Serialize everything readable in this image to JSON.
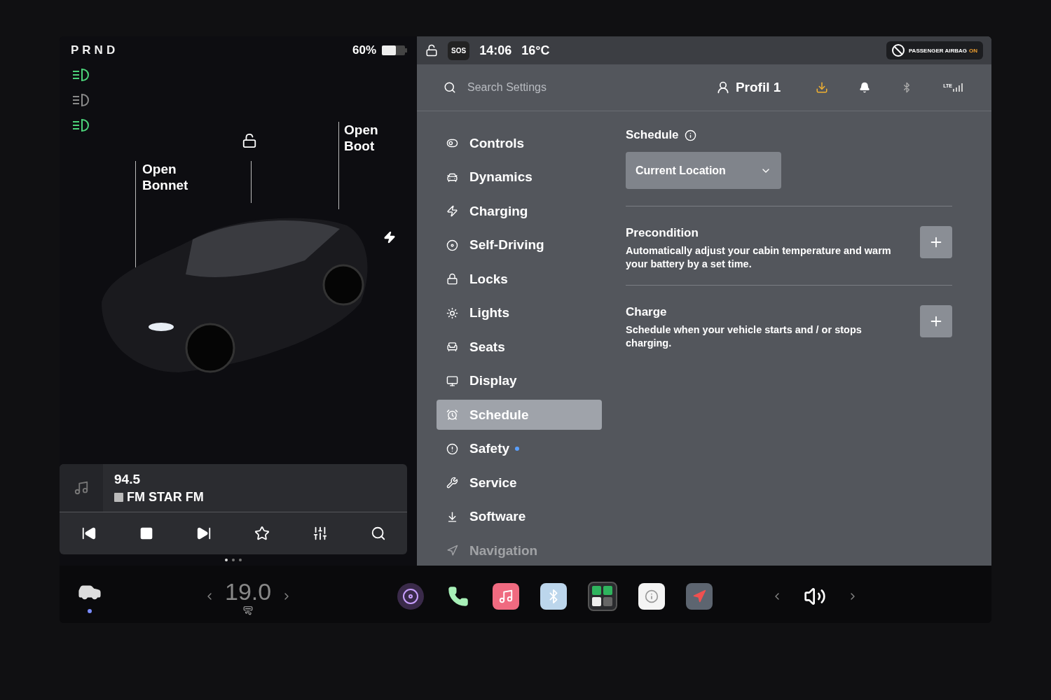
{
  "gear": "PRND",
  "battery": "60%",
  "lights": [
    {
      "on": true
    },
    {
      "on": false
    },
    {
      "on": true
    }
  ],
  "car_labels": [
    "Open Bonnet",
    "Open Boot"
  ],
  "media": {
    "frequency": "94.5",
    "station": "FM STAR FM"
  },
  "page_dots": [
    {
      "selected": true
    },
    {
      "selected": false
    },
    {
      "selected": false
    }
  ],
  "status": {
    "sos": "SOS",
    "time": "14:06",
    "temperature": "16°C",
    "airbag_label": "PASSENGER AIRBAG",
    "airbag_state": "ON"
  },
  "search": {
    "placeholder": "Search Settings"
  },
  "profile": "Profil 1",
  "signal_label": "LTE",
  "menu": [
    {
      "label": "Controls",
      "selected": false,
      "dot": false,
      "dimmed": false
    },
    {
      "label": "Dynamics",
      "selected": false,
      "dot": false,
      "dimmed": false
    },
    {
      "label": "Charging",
      "selected": false,
      "dot": false,
      "dimmed": false
    },
    {
      "label": "Self-Driving",
      "selected": false,
      "dot": false,
      "dimmed": false
    },
    {
      "label": "Locks",
      "selected": false,
      "dot": false,
      "dimmed": false
    },
    {
      "label": "Lights",
      "selected": false,
      "dot": false,
      "dimmed": false
    },
    {
      "label": "Seats",
      "selected": false,
      "dot": false,
      "dimmed": false
    },
    {
      "label": "Display",
      "selected": false,
      "dot": false,
      "dimmed": false
    },
    {
      "label": "Schedule",
      "selected": true,
      "dot": false,
      "dimmed": false
    },
    {
      "label": "Safety",
      "selected": false,
      "dot": true,
      "dimmed": false
    },
    {
      "label": "Service",
      "selected": false,
      "dot": false,
      "dimmed": false
    },
    {
      "label": "Software",
      "selected": false,
      "dot": false,
      "dimmed": false
    },
    {
      "label": "Navigation",
      "selected": false,
      "dot": false,
      "dimmed": true
    }
  ],
  "schedule": {
    "title": "Schedule",
    "location": "Current Location",
    "sections": [
      {
        "title": "Precondition",
        "text": "Automatically adjust your cabin temperature and warm your battery by a set time."
      },
      {
        "title": "Charge",
        "text": "Schedule when your vehicle starts and / or stops charging."
      }
    ]
  },
  "climate": {
    "temperature": "19.0"
  }
}
